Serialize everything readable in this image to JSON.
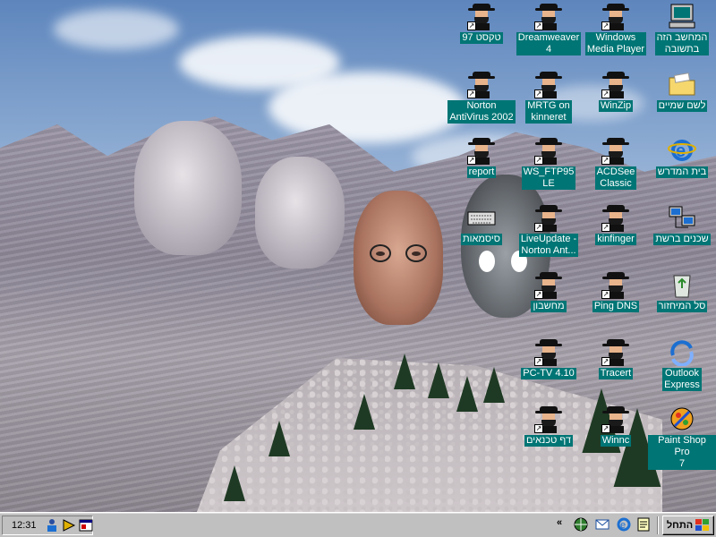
{
  "desktop": {
    "icons": [
      {
        "id": "my-computer",
        "label": "המחשב הזה\nבתשובה",
        "glyph": "computer"
      },
      {
        "id": "windows-media-player",
        "label": "Windows\nMedia Player",
        "glyph": "man"
      },
      {
        "id": "dreamweaver",
        "label": "Dreamweaver\n4",
        "glyph": "man"
      },
      {
        "id": "text97",
        "label": "טקסט 97",
        "glyph": "man"
      },
      {
        "id": "recycle-folder",
        "label": "לשם שמיים",
        "glyph": "folder"
      },
      {
        "id": "winzip",
        "label": "WinZip",
        "glyph": "man"
      },
      {
        "id": "mrtg",
        "label": "MRTG on\nkinneret",
        "glyph": "man"
      },
      {
        "id": "norton-antivirus",
        "label": "Norton\nAntiVirus 2002",
        "glyph": "man"
      },
      {
        "id": "internet-explorer",
        "label": "בית המדרש",
        "glyph": "ie"
      },
      {
        "id": "acdsee",
        "label": "ACDSee\nClassic",
        "glyph": "man"
      },
      {
        "id": "ws-ftp",
        "label": "WS_FTP95\nLE",
        "glyph": "man"
      },
      {
        "id": "report",
        "label": "report",
        "glyph": "man"
      },
      {
        "id": "network-neighborhood",
        "label": "שכנים ברשת",
        "glyph": "network"
      },
      {
        "id": "kinfinger",
        "label": "kinfinger",
        "glyph": "man"
      },
      {
        "id": "liveupdate",
        "label": "LiveUpdate -\nNorton Ant...",
        "glyph": "man"
      },
      {
        "id": "keyboard",
        "label": "סיסמאות",
        "glyph": "keyboard"
      },
      {
        "id": "recycle-bin",
        "label": "סל המיחזור",
        "glyph": "recycle"
      },
      {
        "id": "ping-dns",
        "label": "Ping DNS",
        "glyph": "man"
      },
      {
        "id": "calculator",
        "label": "מחשבון",
        "glyph": "man"
      },
      {
        "id": "outlook-express",
        "label": "Outlook\nExpress",
        "glyph": "outlook"
      },
      {
        "id": "tracert",
        "label": "Tracert",
        "glyph": "man"
      },
      {
        "id": "pc-tv",
        "label": "PC-TV 4.10",
        "glyph": "man"
      },
      {
        "id": "paint-shop-pro",
        "label": "Paint Shop Pro\n7",
        "glyph": "psp"
      },
      {
        "id": "winnc",
        "label": "Winnc",
        "glyph": "man"
      },
      {
        "id": "teachers-page",
        "label": "דף טכנאים",
        "glyph": "man"
      }
    ]
  },
  "taskbar": {
    "clock": "12:31",
    "start_label": "התחל",
    "tray_icons": [
      "user-icon",
      "arrow-icon",
      "window-icon"
    ],
    "quicklaunch": [
      "chevron-icon",
      "network-globe-icon",
      "outlook-icon",
      "ie-icon",
      "notepad-icon",
      "desktop-icon"
    ]
  },
  "colors": {
    "label_bg": "#007575",
    "taskbar": "#c0c0c0"
  }
}
